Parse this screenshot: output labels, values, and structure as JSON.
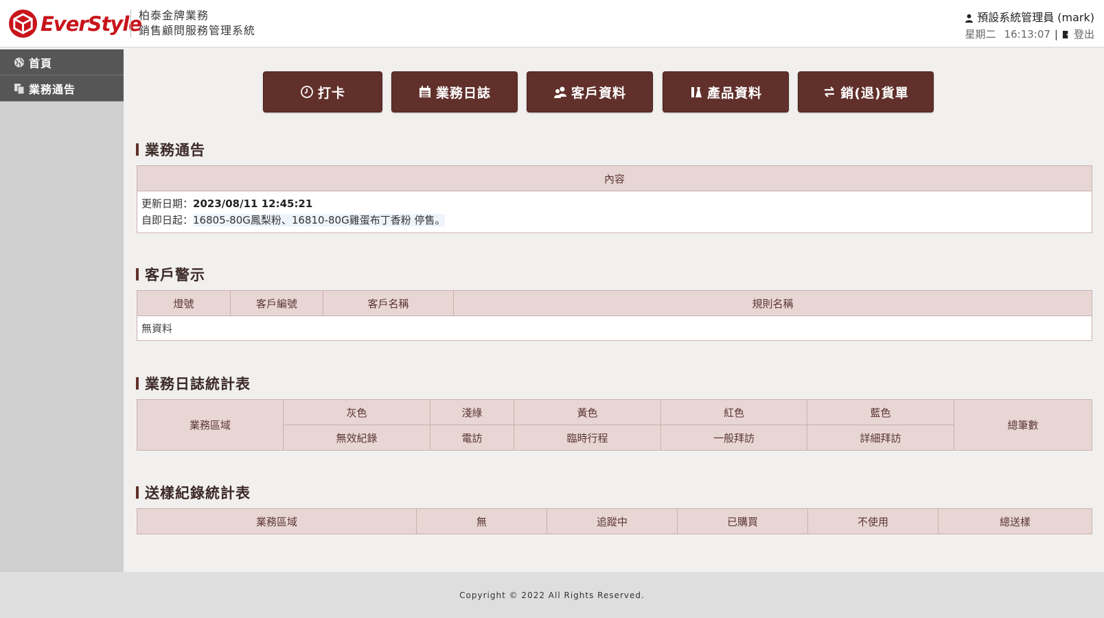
{
  "header": {
    "logo_text": "EverStyle",
    "brand_line1": "柏泰金牌業務",
    "brand_line2": "銷售顧問服務管理系統",
    "user": "預設系統管理員 (mark)",
    "weekday": "星期二",
    "time": "16:13:07",
    "separator": "|",
    "logout": "登出"
  },
  "sidebar": {
    "items": [
      {
        "label": "首頁",
        "icon": "globe-icon"
      },
      {
        "label": "業務通告",
        "icon": "copy-icon"
      }
    ]
  },
  "buttons": {
    "clock_in": "打卡",
    "work_log": "業務日誌",
    "customers": "客戶資料",
    "products": "產品資料",
    "sales_return": "銷(退)貨單"
  },
  "notice": {
    "title": "業務通告",
    "header": "內容",
    "date_label": "更新日期：",
    "date_value": "2023/08/11 12:45:21",
    "content_prefix": "自即日起：",
    "content_body": "16805-80G鳳梨粉、16810-80G雞蛋布丁香粉 停售。"
  },
  "customer_alert": {
    "title": "客戶警示",
    "columns": [
      "燈號",
      "客戶編號",
      "客戶名稱",
      "規則名稱"
    ],
    "empty": "無資料"
  },
  "log_stats": {
    "title": "業務日誌統計表",
    "region": "業務區域",
    "colors": [
      "灰色",
      "淺綠",
      "黃色",
      "紅色",
      "藍色"
    ],
    "types": [
      "無效紀錄",
      "電訪",
      "臨時行程",
      "一般拜訪",
      "詳細拜訪"
    ],
    "total": "總筆數"
  },
  "sample_stats": {
    "title": "送樣紀錄統計表",
    "columns": [
      "業務區域",
      "無",
      "追蹤中",
      "已購買",
      "不使用",
      "總送樣"
    ]
  },
  "footer": {
    "copyright": "Copyright © 2022 All Rights Reserved."
  },
  "colors": {
    "button_bg": "#61302b",
    "table_header_bg": "#e8d6d5",
    "logo_red": "#c8141b",
    "sidebar_item_bg": "#565656"
  }
}
